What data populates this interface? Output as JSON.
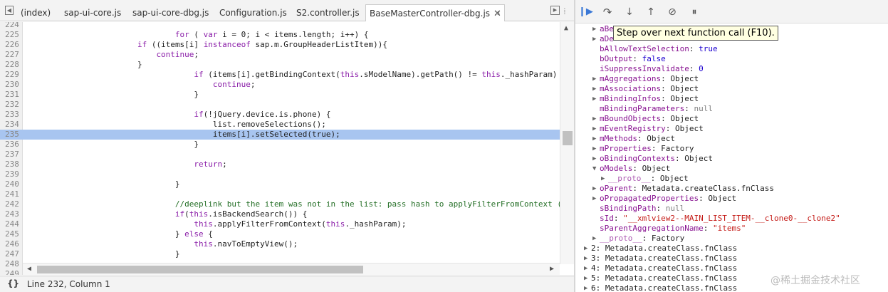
{
  "tabs": {
    "items": [
      "(index)",
      "sap-ui-core.js",
      "sap-ui-core-dbg.js",
      "Configuration.js",
      "S2.controller.js"
    ],
    "active": "BaseMasterController-dbg.js",
    "overflow": "»"
  },
  "editor": {
    "lines": [
      {
        "n": "224",
        "code": ""
      },
      {
        "n": "225",
        "code": "                                for ( var i = 0; i < items.length; i++) {"
      },
      {
        "n": "226",
        "code": "                        if ((items[i] instanceof sap.m.GroupHeaderListItem)){"
      },
      {
        "n": "227",
        "code": "                            continue;"
      },
      {
        "n": "228",
        "code": "                        }"
      },
      {
        "n": "229",
        "code": "                                    if (items[i].getBindingContext(this.sModelName).getPath() != this._hashParam) {"
      },
      {
        "n": "230",
        "code": "                                        continue;"
      },
      {
        "n": "231",
        "code": "                                    }"
      },
      {
        "n": "232",
        "code": ""
      },
      {
        "n": "233",
        "code": "                                    if(!jQuery.device.is.phone) {"
      },
      {
        "n": "234",
        "code": "                                        list.removeSelections();"
      },
      {
        "n": "235",
        "code": "                                        items[i].setSelected(true);"
      },
      {
        "n": "236",
        "code": "                                    }"
      },
      {
        "n": "237",
        "code": ""
      },
      {
        "n": "238",
        "code": "                                    return;"
      },
      {
        "n": "239",
        "code": ""
      },
      {
        "n": "240",
        "code": "                                }"
      },
      {
        "n": "241",
        "code": ""
      },
      {
        "n": "242",
        "code": "                                //deeplink but the item was not in the list: pass hash to applyFilterFromContext (need"
      },
      {
        "n": "243",
        "code": "                                if(this.isBackendSearch()) {"
      },
      {
        "n": "244",
        "code": "                                    this.applyFilterFromContext(this._hashParam);"
      },
      {
        "n": "245",
        "code": "                                } else {"
      },
      {
        "n": "246",
        "code": "                                    this.navToEmptyView();"
      },
      {
        "n": "247",
        "code": "                                }"
      },
      {
        "n": "248",
        "code": ""
      },
      {
        "n": "249",
        "code": ""
      }
    ],
    "highlight_line": "235"
  },
  "status": {
    "braces": "{}",
    "position": "Line 232, Column 1"
  },
  "tooltip": "Step over next function call (F10).",
  "scope": {
    "rows": [
      {
        "indent": 1,
        "tri": "▶",
        "name": "aBe",
        "sep": "",
        "val": "",
        "cls": ""
      },
      {
        "indent": 1,
        "tri": "▶",
        "name": "aDe",
        "sep": "",
        "val": "",
        "cls": ""
      },
      {
        "indent": 1,
        "tri": "",
        "name": "bAllowTextSelection",
        "sep": ": ",
        "val": "true",
        "cls": "pnum"
      },
      {
        "indent": 1,
        "tri": "",
        "name": "bOutput",
        "sep": ": ",
        "val": "false",
        "cls": "pnum"
      },
      {
        "indent": 1,
        "tri": "",
        "name": "iSuppressInvalidate",
        "sep": ": ",
        "val": "0",
        "cls": "pnum"
      },
      {
        "indent": 1,
        "tri": "▶",
        "name": "mAggregations",
        "sep": ": ",
        "val": "Object",
        "cls": ""
      },
      {
        "indent": 1,
        "tri": "▶",
        "name": "mAssociations",
        "sep": ": ",
        "val": "Object",
        "cls": ""
      },
      {
        "indent": 1,
        "tri": "▶",
        "name": "mBindingInfos",
        "sep": ": ",
        "val": "Object",
        "cls": ""
      },
      {
        "indent": 1,
        "tri": "",
        "name": "mBindingParameters",
        "sep": ": ",
        "val": "null",
        "cls": "pnull"
      },
      {
        "indent": 1,
        "tri": "▶",
        "name": "mBoundObjects",
        "sep": ": ",
        "val": "Object",
        "cls": ""
      },
      {
        "indent": 1,
        "tri": "▶",
        "name": "mEventRegistry",
        "sep": ": ",
        "val": "Object",
        "cls": ""
      },
      {
        "indent": 1,
        "tri": "▶",
        "name": "mMethods",
        "sep": ": ",
        "val": "Object",
        "cls": ""
      },
      {
        "indent": 1,
        "tri": "▶",
        "name": "mProperties",
        "sep": ": ",
        "val": "Factory",
        "cls": ""
      },
      {
        "indent": 1,
        "tri": "▶",
        "name": "oBindingContexts",
        "sep": ": ",
        "val": "Object",
        "cls": ""
      },
      {
        "indent": 1,
        "tri": "▼",
        "name": "oModels",
        "sep": ": ",
        "val": "Object",
        "cls": ""
      },
      {
        "indent": 2,
        "tri": "▶",
        "name": "__proto__",
        "sep": ": ",
        "val": "Object",
        "cls": "",
        "gray": true
      },
      {
        "indent": 1,
        "tri": "▶",
        "name": "oParent",
        "sep": ": ",
        "val": "Metadata.createClass.fnClass",
        "cls": ""
      },
      {
        "indent": 1,
        "tri": "▶",
        "name": "oPropagatedProperties",
        "sep": ": ",
        "val": "Object",
        "cls": ""
      },
      {
        "indent": 1,
        "tri": "",
        "name": "sBindingPath",
        "sep": ": ",
        "val": "null",
        "cls": "pnull"
      },
      {
        "indent": 1,
        "tri": "",
        "name": "sId",
        "sep": ": ",
        "val": "\"__xmlview2--MAIN_LIST_ITEM-__clone0-__clone2\"",
        "cls": "pstr"
      },
      {
        "indent": 1,
        "tri": "",
        "name": "sParentAggregationName",
        "sep": ": ",
        "val": "\"items\"",
        "cls": "pstr"
      },
      {
        "indent": 1,
        "tri": "▶",
        "name": "__proto__",
        "sep": ": ",
        "val": "Factory",
        "cls": "",
        "gray": true
      },
      {
        "indent": 0,
        "tri": "▶",
        "name": "2",
        "sep": ": ",
        "val": "Metadata.createClass.fnClass",
        "cls": "",
        "plain": true
      },
      {
        "indent": 0,
        "tri": "▶",
        "name": "3",
        "sep": ": ",
        "val": "Metadata.createClass.fnClass",
        "cls": "",
        "plain": true
      },
      {
        "indent": 0,
        "tri": "▶",
        "name": "4",
        "sep": ": ",
        "val": "Metadata.createClass.fnClass",
        "cls": "",
        "plain": true
      },
      {
        "indent": 0,
        "tri": "▶",
        "name": "5",
        "sep": ": ",
        "val": "Metadata.createClass.fnClass",
        "cls": "",
        "plain": true
      },
      {
        "indent": 0,
        "tri": "▶",
        "name": "6",
        "sep": ": ",
        "val": "Metadata.createClass.fnClass",
        "cls": "",
        "plain": true
      }
    ]
  },
  "watermark": "@稀土掘金技术社区",
  "icons": [
    "sidebar-toggle-icon",
    "pretty-print-icon",
    "resume-icon",
    "step-over-icon",
    "step-into-icon",
    "step-out-icon",
    "deactivate-breakpoints-icon",
    "pause-on-exceptions-icon"
  ]
}
